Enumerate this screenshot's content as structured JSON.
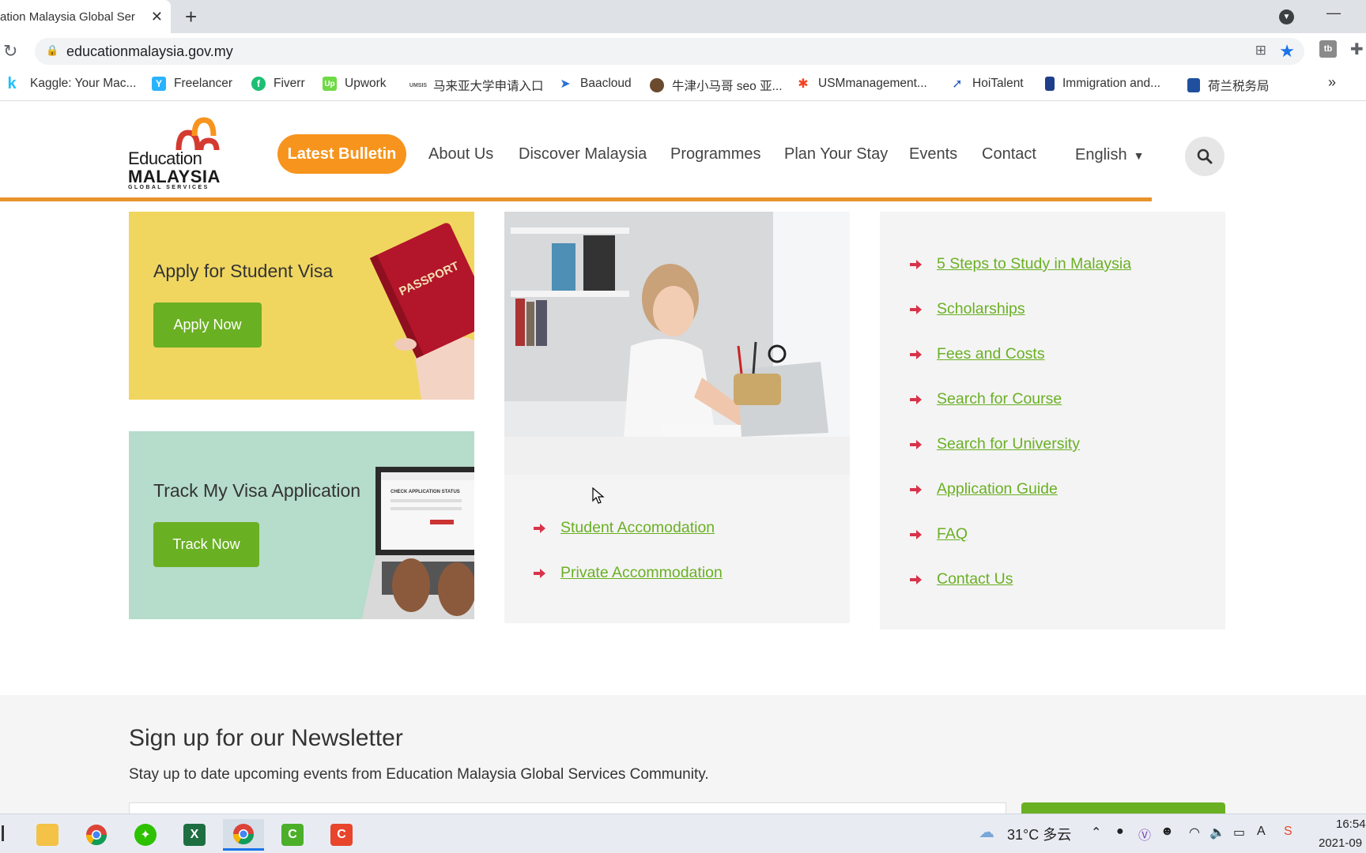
{
  "browser": {
    "tab_title": "ation Malaysia Global Ser",
    "url": "educationmalaysia.gov.my",
    "bookmarks": [
      {
        "label": "Kaggle: Your Mac...",
        "icon": "kaggle-icon"
      },
      {
        "label": "Freelancer",
        "icon": "freelancer-icon"
      },
      {
        "label": "Fiverr",
        "icon": "fiverr-icon"
      },
      {
        "label": "Upwork",
        "icon": "upwork-icon"
      },
      {
        "label": "马来亚大学申请入口",
        "icon": "um-icon"
      },
      {
        "label": "Baacloud",
        "icon": "baacloud-icon"
      },
      {
        "label": "牛津小马哥 seo 亚...",
        "icon": "avatar-icon"
      },
      {
        "label": "USMmanagement...",
        "icon": "joomla-icon"
      },
      {
        "label": "HoiTalent",
        "icon": "hoitalent-icon"
      },
      {
        "label": "Immigration and...",
        "icon": "immigration-icon"
      },
      {
        "label": "荷兰税务局",
        "icon": "tax-office-icon"
      }
    ],
    "bookmarks_more": "»"
  },
  "header": {
    "logo": {
      "line1": "Education",
      "line2": "MALAYSIA",
      "line3": "GLOBAL SERVICES"
    },
    "bulletin_label": "Latest Bulletin",
    "nav": [
      "About Us",
      "Discover Malaysia",
      "Programmes",
      "Plan Your Stay",
      "Events",
      "Contact"
    ],
    "language": "English",
    "accent_color": "#e8932c"
  },
  "cards": {
    "visa": {
      "title": "Apply for Student Visa",
      "button": "Apply Now",
      "passport_text": "PASSPORT"
    },
    "track": {
      "title": "Track My Visa Application",
      "button": "Track Now",
      "screen_text": "CHECK APPLICATION STATUS"
    }
  },
  "accommodation_links": [
    "Student Accomodation",
    "Private Accommodation"
  ],
  "quick_links": [
    "5 Steps to Study in Malaysia",
    "Scholarships",
    "Fees and Costs",
    "Search for Course",
    "Search for University",
    "Application Guide",
    "FAQ",
    "Contact Us"
  ],
  "newsletter": {
    "title": "Sign up for our Newsletter",
    "subtitle": "Stay up to date upcoming events from Education Malaysia Global Services Community."
  },
  "taskbar": {
    "weather": "31°C 多云",
    "time": "16:54",
    "date": "2021-09"
  },
  "colors": {
    "link_green": "#6ab023",
    "bulletin_orange": "#f7941d",
    "arrow_red": "#d8334a"
  }
}
